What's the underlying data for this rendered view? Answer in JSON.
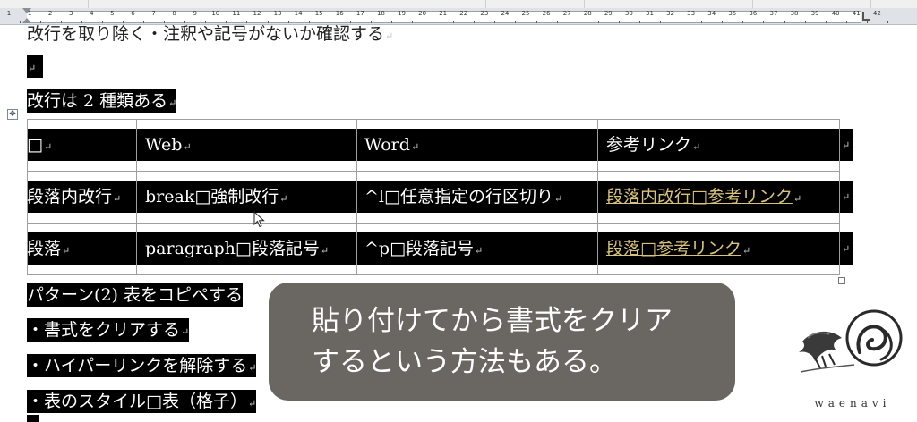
{
  "ruler": {
    "numbers": [
      "1",
      "1",
      "2",
      "3",
      "4",
      "5",
      "6",
      "7",
      "8",
      "9",
      "10",
      "11",
      "12",
      "13",
      "14",
      "15",
      "16",
      "17",
      "18",
      "19",
      "20",
      "21",
      "22",
      "23",
      "24",
      "25",
      "26",
      "27",
      "28",
      "29",
      "30",
      "31",
      "32",
      "33",
      "34",
      "35",
      "36",
      "37",
      "38",
      "39",
      "40",
      "41",
      "42"
    ]
  },
  "document": {
    "heading_partial": "改行を取り除く・注釈や記号がないか確認する",
    "section_title": "改行は 2 種類ある",
    "table": {
      "headers": [
        "□",
        "Web",
        "Word",
        "参考リンク"
      ],
      "rows": [
        [
          "段落内改行",
          "break□強制改行",
          "^l□任意指定の行区切り",
          "段落内改行□参考リンク"
        ],
        [
          "段落",
          "paragraph□段落記号",
          "^p□段落記号",
          "段落□参考リンク"
        ]
      ]
    },
    "pattern_title": "パターン(2) 表をコピペする",
    "bullets": [
      "・書式をクリアする",
      "・ハイパーリンクを解除する",
      "・表のスタイル□表（格子）"
    ]
  },
  "caption": {
    "line1": "貼り付けてから書式をクリア",
    "line2": "するという方法もある。"
  },
  "logo": {
    "text": "waenavi"
  },
  "colors": {
    "highlight": "#000000",
    "link": "#d8c37a",
    "caption_bg": "#5f5a56"
  }
}
